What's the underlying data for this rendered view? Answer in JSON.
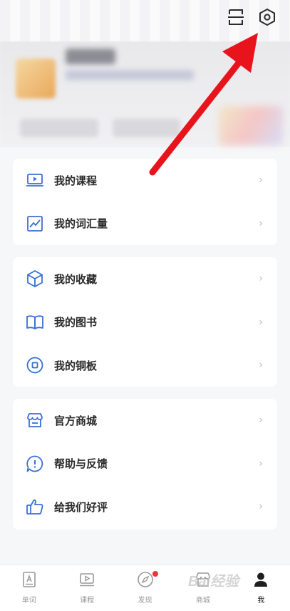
{
  "header": {
    "scan_icon": "scan-icon",
    "settings_icon": "settings-hexagon-icon"
  },
  "menu": {
    "group1": [
      {
        "label": "我的课程",
        "icon": "laptop-play-icon"
      },
      {
        "label": "我的词汇量",
        "icon": "line-chart-icon"
      }
    ],
    "group2": [
      {
        "label": "我的收藏",
        "icon": "cube-icon"
      },
      {
        "label": "我的图书",
        "icon": "open-book-icon"
      },
      {
        "label": "我的铜板",
        "icon": "coin-icon"
      }
    ],
    "group3": [
      {
        "label": "官方商城",
        "icon": "store-icon"
      },
      {
        "label": "帮助与反馈",
        "icon": "help-bubble-icon"
      },
      {
        "label": "给我们好评",
        "icon": "thumbs-up-icon"
      }
    ],
    "chevron": "›"
  },
  "bottom_nav": [
    {
      "label": "单词",
      "icon": "word-book-icon"
    },
    {
      "label": "课程",
      "icon": "course-screen-icon"
    },
    {
      "label": "发现",
      "icon": "compass-icon",
      "badge": true
    },
    {
      "label": "商城",
      "icon": "shop-icon"
    },
    {
      "label": "我",
      "icon": "person-icon",
      "active": true
    }
  ],
  "watermark": "Bai经验",
  "colors": {
    "accent_blue": "#3b6fd8",
    "annotation_red": "#e8141c",
    "badge_red": "#ee3333"
  }
}
